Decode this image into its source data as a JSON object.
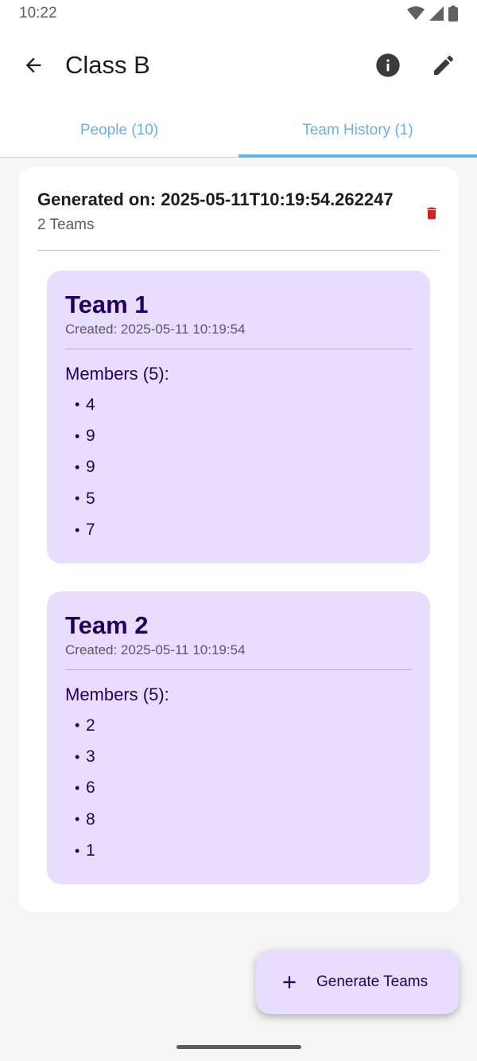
{
  "status_bar": {
    "time": "10:22",
    "icons": [
      "wifi-icon",
      "signal-icon",
      "battery-icon"
    ]
  },
  "app_bar": {
    "title": "Class B",
    "back_icon": "arrow-back-icon",
    "actions": [
      "info-icon",
      "edit-icon"
    ]
  },
  "tabs": [
    {
      "label": "People (10)",
      "active": false
    },
    {
      "label": "Team History (1)",
      "active": true
    }
  ],
  "history": {
    "generated_label": "Generated on: 2025-05-11T10:19:54.262247",
    "teams_count_label": "2 Teams",
    "delete_icon": "trash-icon",
    "teams": [
      {
        "name": "Team 1",
        "created": "Created: 2025-05-11 10:19:54",
        "members_label": "Members (5):",
        "members": [
          "4",
          "9",
          "9",
          "5",
          "7"
        ]
      },
      {
        "name": "Team 2",
        "created": "Created: 2025-05-11 10:19:54",
        "members_label": "Members (5):",
        "members": [
          "2",
          "3",
          "6",
          "8",
          "1"
        ]
      }
    ]
  },
  "fab": {
    "label": "Generate Teams",
    "icon": "plus-icon"
  },
  "colors": {
    "accent": "#6aaee6",
    "team_card_bg": "#e8ddff",
    "team_text": "#21005d",
    "delete": "#c62828"
  }
}
